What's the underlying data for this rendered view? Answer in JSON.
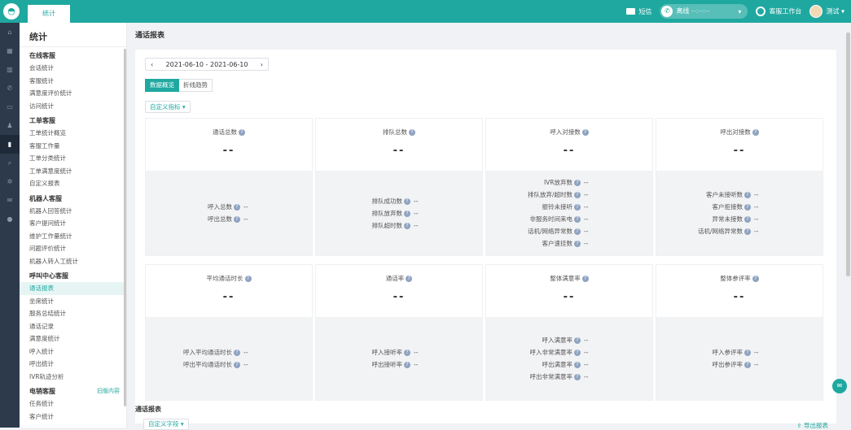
{
  "topbar": {
    "tab": "统计",
    "sms": "短信",
    "status": "离线",
    "timer": "--:--:--",
    "workspace": "客服工作台",
    "user": "测试"
  },
  "iconrail": [
    "home-icon",
    "grid-icon",
    "trash-icon",
    "phone-icon",
    "chat-icon",
    "users-icon",
    "chart-icon",
    "search-icon",
    "gear-icon",
    "mail-icon",
    "info-icon"
  ],
  "sidebar": {
    "title": "统计",
    "sections": [
      {
        "name": "在线客服",
        "items": [
          "会话统计",
          "客服统计",
          "满意度评价统计",
          "访问统计"
        ]
      },
      {
        "name": "工单客服",
        "items": [
          "工单统计概览",
          "客服工作量",
          "工单分类统计",
          "工单满意度统计",
          "自定义报表"
        ]
      },
      {
        "name": "机器人客服",
        "items": [
          "机器人回答统计",
          "客户提问统计",
          "维护工作量统计",
          "问题评价统计",
          "机器人转人工统计"
        ]
      },
      {
        "name": "呼叫中心客服",
        "items": [
          "通话报表",
          "坐席统计",
          "服务总结统计",
          "通话记录",
          "满意度统计",
          "呼入统计",
          "呼出统计",
          "IVR轨迹分析"
        ]
      },
      {
        "name": "电销客服",
        "extra": "旧版内容",
        "items": [
          "任务统计",
          "客户统计"
        ]
      }
    ]
  },
  "main": {
    "title": "通话报表",
    "date_range": "2021-06-10 - 2021-06-10",
    "seg": [
      "数据概览",
      "折线趋势"
    ],
    "custom_metric": "自定义指标",
    "stats": [
      {
        "label": "通话总数",
        "value": "--",
        "rows": [
          [
            "呼入总数",
            "--"
          ],
          [
            "呼出总数",
            "--"
          ]
        ]
      },
      {
        "label": "排队总数",
        "value": "--",
        "rows": [
          [
            "排队成功数",
            "--"
          ],
          [
            "排队放弃数",
            "--"
          ],
          [
            "排队超时数",
            "--"
          ]
        ]
      },
      {
        "label": "呼入对接数",
        "value": "--",
        "rows": [
          [
            "IVR放弃数",
            "--"
          ],
          [
            "排队放弃/超时数",
            "--"
          ],
          [
            "振铃未接听",
            "--"
          ],
          [
            "非服务时间来电",
            "--"
          ],
          [
            "话机/网络异常数",
            "--"
          ],
          [
            "客户速挂数",
            "--"
          ]
        ]
      },
      {
        "label": "呼出对接数",
        "value": "--",
        "rows": [
          [
            "客户未接听数",
            "--"
          ],
          [
            "客户拒接数",
            "--"
          ],
          [
            "异常未接数",
            "--"
          ],
          [
            "话机/网络异常数",
            "--"
          ]
        ]
      },
      {
        "label": "平均通话时长",
        "value": "--",
        "rows": [
          [
            "呼入平均通话时长",
            "--"
          ],
          [
            "呼出平均通话时长",
            "--"
          ]
        ]
      },
      {
        "label": "通话率",
        "value": "--",
        "rows": [
          [
            "呼入接听率",
            "--"
          ],
          [
            "呼出接听率",
            "--"
          ]
        ]
      },
      {
        "label": "整体满意率",
        "value": "--",
        "rows": [
          [
            "呼入满意率",
            "--"
          ],
          [
            "呼入非常满意率",
            "--"
          ],
          [
            "呼出满意率",
            "--"
          ],
          [
            "呼出非常满意率",
            "--"
          ]
        ]
      },
      {
        "label": "整体参评率",
        "value": "--",
        "rows": [
          [
            "呼入参评率",
            "--"
          ],
          [
            "呼出参评率",
            "--"
          ]
        ]
      }
    ],
    "section2": "通话报表",
    "custom_field": "自定义字段",
    "export": "导出报表"
  }
}
